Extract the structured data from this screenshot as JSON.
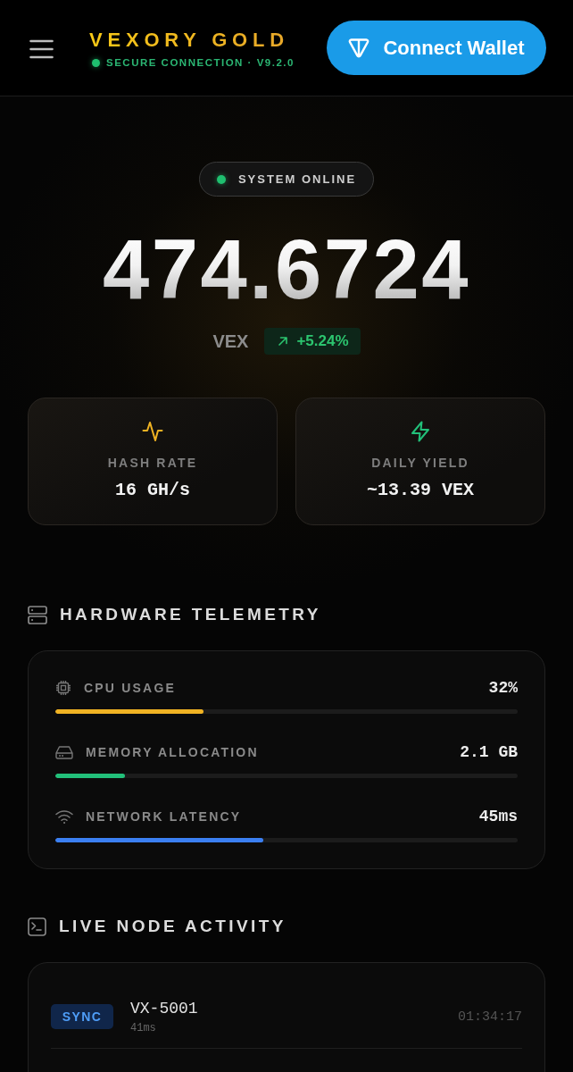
{
  "header": {
    "brand": "VEXORY GOLD",
    "connection": {
      "label": "SECURE CONNECTION · V9.2.0",
      "secure": true
    },
    "wallet_button": "Connect Wallet"
  },
  "hero": {
    "status": {
      "label": "SYSTEM ONLINE",
      "online": true
    },
    "balance": "474.6724",
    "unit": "VEX",
    "change": {
      "value": "+5.24%",
      "up": true
    }
  },
  "stats": [
    {
      "label": "HASH RATE",
      "value": "16 GH/s"
    },
    {
      "label": "DAILY YIELD",
      "value": "~13.39 VEX"
    }
  ],
  "telemetry": {
    "title": "HARDWARE TELEMETRY",
    "rows": [
      {
        "label": "CPU USAGE",
        "reading": "32%",
        "level": 0.32,
        "color": "#f0b323"
      },
      {
        "label": "MEMORY ALLOCATION",
        "reading": "2.1 GB",
        "level": 0.15,
        "color": "#22c07a"
      },
      {
        "label": "NETWORK LATENCY",
        "reading": "45ms",
        "level": 0.45,
        "color": "#3b7ff2"
      }
    ]
  },
  "activity": {
    "title": "LIVE NODE ACTIVITY",
    "rows": [
      {
        "status": "SYNC",
        "node": "VX-5001",
        "latency": "41ms",
        "time": "01:34:17"
      }
    ]
  }
}
